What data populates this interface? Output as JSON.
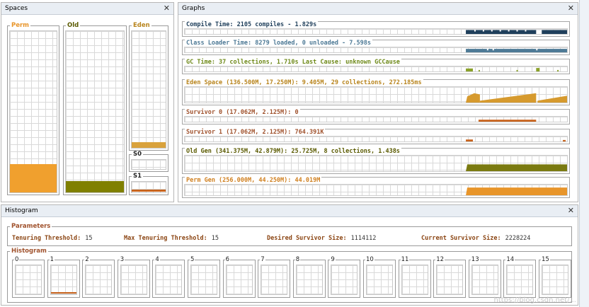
{
  "spaces": {
    "title": "Spaces",
    "perm": {
      "label": "Perm",
      "color": "#f0a02e",
      "fill": 0.17
    },
    "old": {
      "label": "Old",
      "color": "#808000",
      "fill": 0.07
    },
    "eden": {
      "label": "Eden",
      "color": "#d9a23c",
      "fill": 0.05
    },
    "s0": {
      "label": "S0",
      "color": "#c8641e",
      "fill": 0
    },
    "s1": {
      "label": "S1",
      "color": "#c8641e",
      "fill": 0.15
    }
  },
  "graphs": {
    "title": "Graphs",
    "rows": [
      {
        "label": "Compile Time: 2105 compiles - 1.829s",
        "color": "#1f3f5b",
        "label_color": "#1f3f5b"
      },
      {
        "label": "Class Loader Time: 8279 loaded, 0 unloaded - 7.598s",
        "color": "#4e7a96",
        "label_color": "#4e7a96"
      },
      {
        "label": "GC Time: 37 collections, 1.710s  Last Cause: unknown GCCause",
        "color": "#8aa12a",
        "label_color": "#6f8a1a"
      },
      {
        "label": "Eden Space (136.500M, 17.250M): 9.405M, 29 collections, 272.185ms",
        "color": "#d69a2e",
        "label_color": "#b8841c"
      },
      {
        "label": "Survivor 0 (17.062M, 2.125M): 0",
        "color": "#c8641e",
        "label_color": "#a0522d"
      },
      {
        "label": "Survivor 1 (17.062M, 2.125M): 764.391K",
        "color": "#c8641e",
        "label_color": "#a0522d"
      },
      {
        "label": "Old Gen (341.375M, 42.879M): 25.725M, 8 collections, 1.438s",
        "color": "#7a7a10",
        "label_color": "#5a5a00"
      },
      {
        "label": "Perm Gen (256.000M, 44.250M): 44.019M",
        "color": "#e8952a",
        "label_color": "#d08020"
      }
    ]
  },
  "histogram": {
    "title": "Histogram",
    "parameters_label": "Parameters",
    "tenuring_label": "Tenuring Threshold:",
    "tenuring_value": "15",
    "max_tenuring_label": "Max Tenuring Threshold:",
    "max_tenuring_value": "15",
    "desired_label": "Desired Survivor Size:",
    "desired_value": "1114112",
    "current_label": "Current Survivor Size:",
    "current_value": "2228224",
    "histogram_label": "Histogram",
    "buckets": [
      "0",
      "1",
      "2",
      "3",
      "4",
      "5",
      "6",
      "7",
      "8",
      "9",
      "10",
      "11",
      "12",
      "13",
      "14",
      "15"
    ],
    "bar_color": "#c8641e"
  },
  "icons": {
    "close": "close-icon"
  },
  "watermark": "https://blog.csdn.net/..."
}
